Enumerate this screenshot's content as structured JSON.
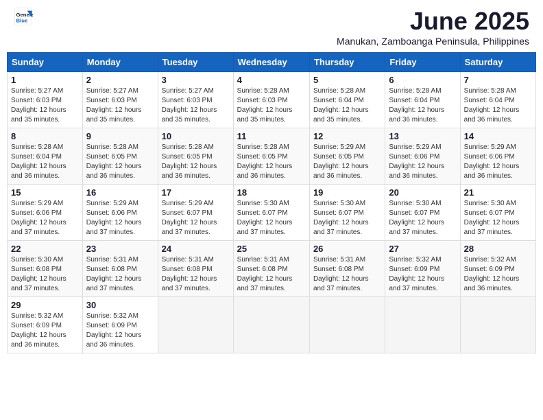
{
  "header": {
    "logo_general": "General",
    "logo_blue": "Blue",
    "month_title": "June 2025",
    "location": "Manukan, Zamboanga Peninsula, Philippines"
  },
  "weekdays": [
    "Sunday",
    "Monday",
    "Tuesday",
    "Wednesday",
    "Thursday",
    "Friday",
    "Saturday"
  ],
  "weeks": [
    [
      {
        "day": "1",
        "info": "Sunrise: 5:27 AM\nSunset: 6:03 PM\nDaylight: 12 hours\nand 35 minutes."
      },
      {
        "day": "2",
        "info": "Sunrise: 5:27 AM\nSunset: 6:03 PM\nDaylight: 12 hours\nand 35 minutes."
      },
      {
        "day": "3",
        "info": "Sunrise: 5:27 AM\nSunset: 6:03 PM\nDaylight: 12 hours\nand 35 minutes."
      },
      {
        "day": "4",
        "info": "Sunrise: 5:28 AM\nSunset: 6:03 PM\nDaylight: 12 hours\nand 35 minutes."
      },
      {
        "day": "5",
        "info": "Sunrise: 5:28 AM\nSunset: 6:04 PM\nDaylight: 12 hours\nand 35 minutes."
      },
      {
        "day": "6",
        "info": "Sunrise: 5:28 AM\nSunset: 6:04 PM\nDaylight: 12 hours\nand 36 minutes."
      },
      {
        "day": "7",
        "info": "Sunrise: 5:28 AM\nSunset: 6:04 PM\nDaylight: 12 hours\nand 36 minutes."
      }
    ],
    [
      {
        "day": "8",
        "info": "Sunrise: 5:28 AM\nSunset: 6:04 PM\nDaylight: 12 hours\nand 36 minutes."
      },
      {
        "day": "9",
        "info": "Sunrise: 5:28 AM\nSunset: 6:05 PM\nDaylight: 12 hours\nand 36 minutes."
      },
      {
        "day": "10",
        "info": "Sunrise: 5:28 AM\nSunset: 6:05 PM\nDaylight: 12 hours\nand 36 minutes."
      },
      {
        "day": "11",
        "info": "Sunrise: 5:28 AM\nSunset: 6:05 PM\nDaylight: 12 hours\nand 36 minutes."
      },
      {
        "day": "12",
        "info": "Sunrise: 5:29 AM\nSunset: 6:05 PM\nDaylight: 12 hours\nand 36 minutes."
      },
      {
        "day": "13",
        "info": "Sunrise: 5:29 AM\nSunset: 6:06 PM\nDaylight: 12 hours\nand 36 minutes."
      },
      {
        "day": "14",
        "info": "Sunrise: 5:29 AM\nSunset: 6:06 PM\nDaylight: 12 hours\nand 36 minutes."
      }
    ],
    [
      {
        "day": "15",
        "info": "Sunrise: 5:29 AM\nSunset: 6:06 PM\nDaylight: 12 hours\nand 37 minutes."
      },
      {
        "day": "16",
        "info": "Sunrise: 5:29 AM\nSunset: 6:06 PM\nDaylight: 12 hours\nand 37 minutes."
      },
      {
        "day": "17",
        "info": "Sunrise: 5:29 AM\nSunset: 6:07 PM\nDaylight: 12 hours\nand 37 minutes."
      },
      {
        "day": "18",
        "info": "Sunrise: 5:30 AM\nSunset: 6:07 PM\nDaylight: 12 hours\nand 37 minutes."
      },
      {
        "day": "19",
        "info": "Sunrise: 5:30 AM\nSunset: 6:07 PM\nDaylight: 12 hours\nand 37 minutes."
      },
      {
        "day": "20",
        "info": "Sunrise: 5:30 AM\nSunset: 6:07 PM\nDaylight: 12 hours\nand 37 minutes."
      },
      {
        "day": "21",
        "info": "Sunrise: 5:30 AM\nSunset: 6:07 PM\nDaylight: 12 hours\nand 37 minutes."
      }
    ],
    [
      {
        "day": "22",
        "info": "Sunrise: 5:30 AM\nSunset: 6:08 PM\nDaylight: 12 hours\nand 37 minutes."
      },
      {
        "day": "23",
        "info": "Sunrise: 5:31 AM\nSunset: 6:08 PM\nDaylight: 12 hours\nand 37 minutes."
      },
      {
        "day": "24",
        "info": "Sunrise: 5:31 AM\nSunset: 6:08 PM\nDaylight: 12 hours\nand 37 minutes."
      },
      {
        "day": "25",
        "info": "Sunrise: 5:31 AM\nSunset: 6:08 PM\nDaylight: 12 hours\nand 37 minutes."
      },
      {
        "day": "26",
        "info": "Sunrise: 5:31 AM\nSunset: 6:08 PM\nDaylight: 12 hours\nand 37 minutes."
      },
      {
        "day": "27",
        "info": "Sunrise: 5:32 AM\nSunset: 6:09 PM\nDaylight: 12 hours\nand 37 minutes."
      },
      {
        "day": "28",
        "info": "Sunrise: 5:32 AM\nSunset: 6:09 PM\nDaylight: 12 hours\nand 36 minutes."
      }
    ],
    [
      {
        "day": "29",
        "info": "Sunrise: 5:32 AM\nSunset: 6:09 PM\nDaylight: 12 hours\nand 36 minutes."
      },
      {
        "day": "30",
        "info": "Sunrise: 5:32 AM\nSunset: 6:09 PM\nDaylight: 12 hours\nand 36 minutes."
      },
      {
        "day": "",
        "info": ""
      },
      {
        "day": "",
        "info": ""
      },
      {
        "day": "",
        "info": ""
      },
      {
        "day": "",
        "info": ""
      },
      {
        "day": "",
        "info": ""
      }
    ]
  ]
}
